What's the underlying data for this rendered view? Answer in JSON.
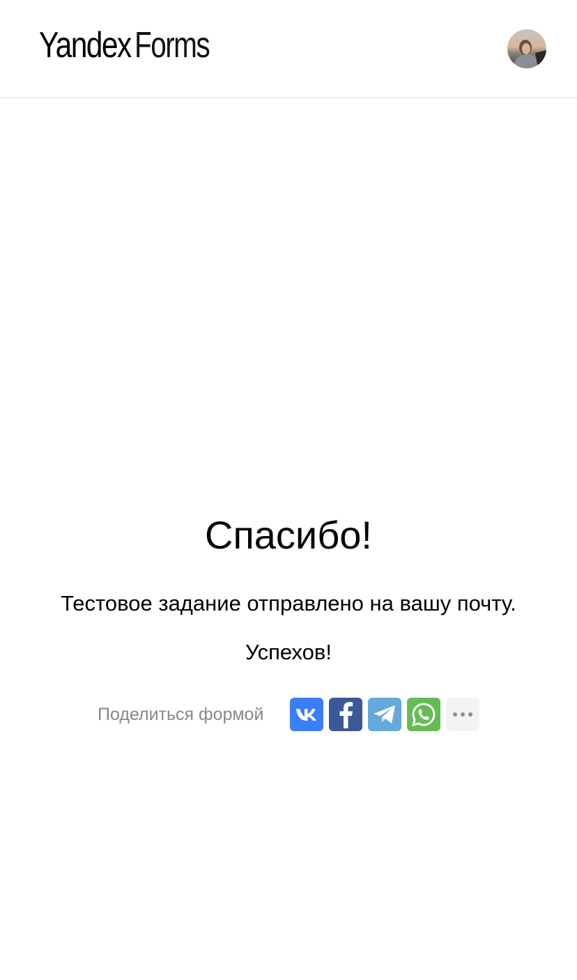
{
  "header": {
    "logo_brand": "Yandex",
    "logo_product": "Forms",
    "avatar_icon": "user-avatar-photo"
  },
  "main": {
    "title": "Спасибо!",
    "message": "Тестовое задание отправлено на вашу почту.",
    "wish": "Успехов!"
  },
  "share": {
    "label": "Поделиться формой",
    "buttons": [
      {
        "icon": "vk-icon",
        "color": "#3b7ef7"
      },
      {
        "icon": "facebook-icon",
        "color": "#3b5998"
      },
      {
        "icon": "telegram-icon",
        "color": "#64a9dc"
      },
      {
        "icon": "whatsapp-icon",
        "color": "#65bc54"
      },
      {
        "icon": "more-icon",
        "color": "#f3f3f3"
      }
    ]
  }
}
